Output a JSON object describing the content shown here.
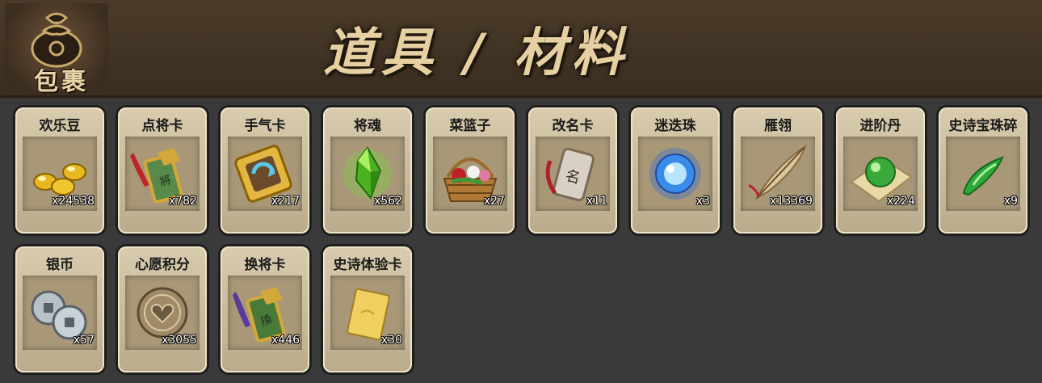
{
  "header": {
    "bag_label": "包裹",
    "bag_icon": "coin-bag-icon",
    "title": "道具 / 材料"
  },
  "items": [
    {
      "name": "欢乐豆",
      "count": "x24538",
      "icon": "gold-beans-icon"
    },
    {
      "name": "点将卡",
      "count": "x782",
      "icon": "general-token-icon"
    },
    {
      "name": "手气卡",
      "count": "x217",
      "icon": "luck-card-icon"
    },
    {
      "name": "将魂",
      "count": "x562",
      "icon": "green-crystal-icon"
    },
    {
      "name": "菜篮子",
      "count": "x27",
      "icon": "flower-basket-icon"
    },
    {
      "name": "改名卡",
      "count": "x11",
      "icon": "rename-scroll-icon"
    },
    {
      "name": "迷迭珠",
      "count": "x3",
      "icon": "blue-orb-icon"
    },
    {
      "name": "雁翎",
      "count": "x13369",
      "icon": "feather-icon"
    },
    {
      "name": "进阶丹",
      "count": "x224",
      "icon": "green-pill-icon"
    },
    {
      "name": "史诗宝珠碎",
      "count": "x9",
      "icon": "jade-shard-icon"
    },
    {
      "name": "银币",
      "count": "x57",
      "icon": "silver-coins-icon"
    },
    {
      "name": "心愿积分",
      "count": "x3055",
      "icon": "heart-coin-icon"
    },
    {
      "name": "换将卡",
      "count": "x446",
      "icon": "swap-general-token-icon"
    },
    {
      "name": "史诗体验卡",
      "count": "x30",
      "icon": "gold-card-icon"
    }
  ]
}
